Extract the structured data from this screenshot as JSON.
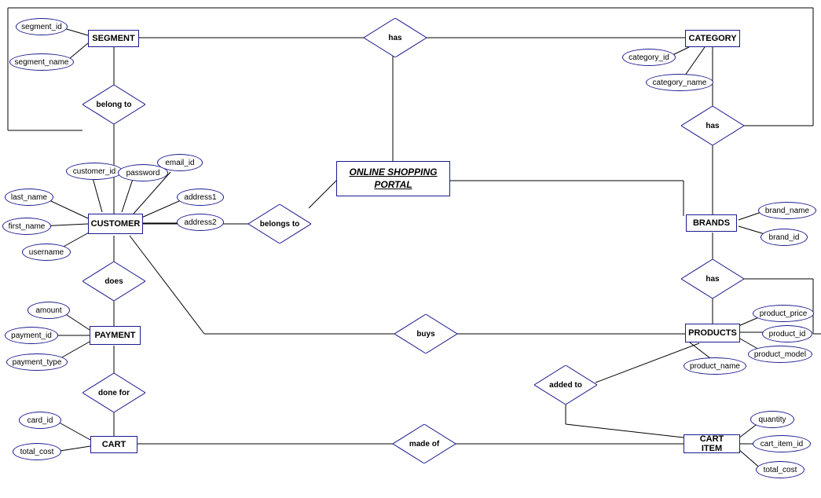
{
  "title": "ONLINE SHOPPING PORTAL",
  "entities": {
    "segment": "SEGMENT",
    "category": "CATEGORY",
    "customer": "CUSTOMER",
    "brands": "BRANDS",
    "payment": "PAYMENT",
    "products": "PRODUCTS",
    "cart": "CART",
    "cart_item": "CART ITEM"
  },
  "relationships": {
    "has1": "has",
    "belong_to": "belong to",
    "has2": "has",
    "belongs_to": "belongs to",
    "does": "does",
    "has3": "has",
    "buys": "buys",
    "done_for": "done for",
    "added_to": "added to",
    "made_of": "made of"
  },
  "attributes": {
    "segment_id": "segment_id",
    "segment_name": "segment_name",
    "category_id": "category_id",
    "category_name": "category_name",
    "customer_id": "customer_id",
    "password": "password",
    "email_id": "email_id",
    "address1": "address1",
    "address2": "address2",
    "last_name": "last_name",
    "first_name": "first_name",
    "username": "username",
    "brand_name": "brand_name",
    "brand_id": "brand_id",
    "amount": "amount",
    "payment_id": "payment_id",
    "payment_type": "payment_type",
    "product_price": "product_price",
    "product_id": "product_id",
    "product_model": "product_model",
    "product_name": "product_name",
    "card_id": "card_id",
    "total_cost_cart": "total_cost",
    "quantity": "quantity",
    "cart_item_id": "cart_item_id",
    "total_cost_item": "total_cost"
  }
}
